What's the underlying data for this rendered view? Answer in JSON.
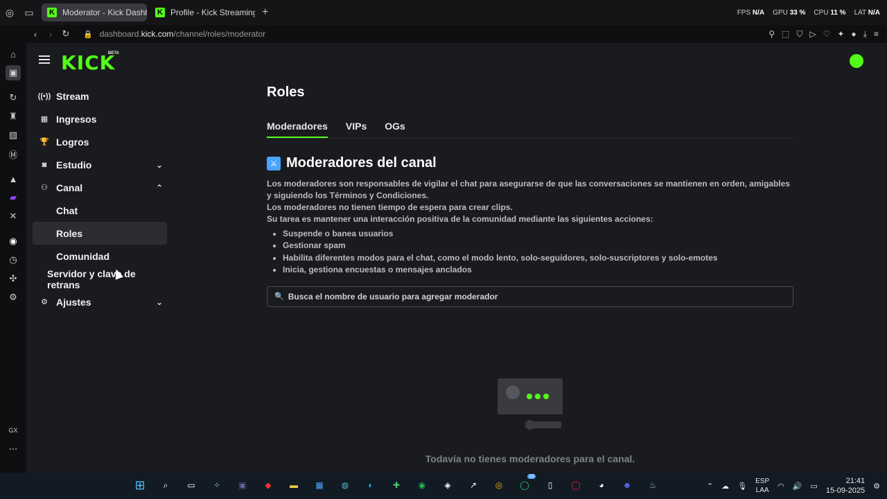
{
  "browser": {
    "tabs": [
      {
        "label": "Moderator - Kick Dashbo",
        "active": true
      },
      {
        "label": "Profile - Kick Streaming",
        "active": false
      }
    ],
    "stats": {
      "fps_label": "FPS",
      "fps_value": "N/A",
      "gpu_label": "GPU",
      "gpu_value": "33 %",
      "cpu_label": "CPU",
      "cpu_value": "11 %",
      "net_label": "LAT",
      "net_value": "N/A"
    },
    "url_prefix": "dashboard.",
    "url_domain": "kick.com",
    "url_path": "/channel/roles/moderator"
  },
  "kick": {
    "logo": "KICK",
    "beta": "BETA",
    "brand_color": "#53fc18"
  },
  "sidebar": {
    "items": [
      {
        "label": "Stream",
        "icon": "broadcast-icon"
      },
      {
        "label": "Ingresos",
        "icon": "revenue-icon"
      },
      {
        "label": "Logros",
        "icon": "trophy-icon"
      },
      {
        "label": "Estudio",
        "icon": "studio-icon"
      },
      {
        "label": "Canal",
        "icon": "channel-icon"
      },
      {
        "label": "Chat"
      },
      {
        "label": "Roles"
      },
      {
        "label": "Comunidad"
      },
      {
        "label": "Servidor y clave de retrans"
      },
      {
        "label": "Ajustes",
        "icon": "gear-icon"
      }
    ]
  },
  "main": {
    "title": "Roles",
    "tabs": [
      "Moderadores",
      "VIPs",
      "OGs"
    ],
    "section_title": "Moderadores del canal",
    "desc_lines": [
      "Los moderadores son responsables de vigilar el chat para asegurarse de que las conversaciones se mantienen en orden, amigables y siguiendo los Términos y Condiciones.",
      "Los moderadores no tienen tiempo de espera para crear clips.",
      "Su tarea es mantener una interacción positiva de la comunidad mediante las siguientes acciones:"
    ],
    "bullets": [
      "Suspende o banea usuarios",
      "Gestionar spam",
      "Habilita diferentes modos para el chat, como el modo lento, solo-seguidores, solo-suscriptores y solo-emotes",
      "Inicia, gestiona encuestas o mensajes anclados"
    ],
    "search_placeholder": "Busca el nombre de usuario para agregar moderador",
    "empty_text": "Todavía no tienes moderadores para el canal."
  },
  "taskbar": {
    "lang_top": "ESP",
    "lang_bottom": "LAA",
    "time": "21:41",
    "date": "15-09-2025",
    "whatsapp_badge": "15"
  }
}
